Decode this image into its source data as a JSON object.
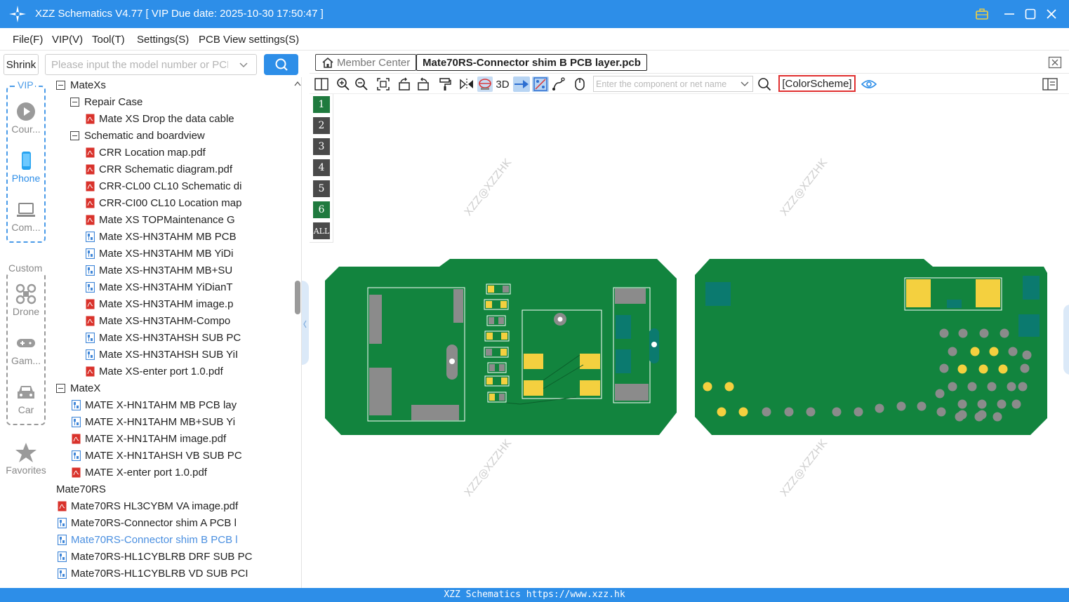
{
  "window": {
    "title": "XZZ Schematics V4.77 [ VIP Due date: 2025-10-30 17:50:47 ]"
  },
  "menu": [
    "File(F)",
    "VIP(V)",
    "Tool(T)",
    "Settings(S)",
    "PCB View settings(S)"
  ],
  "search": {
    "shrink_label": "Shrink",
    "placeholder": "Please input the model number or PCB"
  },
  "rail": {
    "vip_label": "VIP",
    "custom_label": "Custom",
    "items": [
      "Cour...",
      "Phone",
      "Com...",
      "Drone",
      "Gam...",
      "Car",
      "Favorites"
    ]
  },
  "tree": [
    {
      "label": "MateXs",
      "kind": "folder"
    },
    {
      "label": "Repair Case",
      "kind": "folder"
    },
    {
      "label": "Mate XS Drop the data cable",
      "kind": "pdf"
    },
    {
      "label": "Schematic and boardview",
      "kind": "folder"
    },
    {
      "label": "CRR Location map.pdf",
      "kind": "pdf"
    },
    {
      "label": "CRR Schematic diagram.pdf",
      "kind": "pdf"
    },
    {
      "label": "CRR-CL00 CL10 Schematic di",
      "kind": "pdf"
    },
    {
      "label": "CRR-CI00 CL10 Location map",
      "kind": "pdf"
    },
    {
      "label": "Mate XS TOPMaintenance G",
      "kind": "pdf"
    },
    {
      "label": "Mate XS-HN3TAHM MB PCB",
      "kind": "pcb"
    },
    {
      "label": "Mate XS-HN3TAHM MB YiDi",
      "kind": "pcb"
    },
    {
      "label": "Mate XS-HN3TAHM MB+SU",
      "kind": "pcb"
    },
    {
      "label": "Mate XS-HN3TAHM YiDianT",
      "kind": "pcb"
    },
    {
      "label": "Mate XS-HN3TAHM image.p",
      "kind": "pdf"
    },
    {
      "label": "Mate XS-HN3TAHM-Compo",
      "kind": "pdf"
    },
    {
      "label": "Mate XS-HN3TAHSH SUB PC",
      "kind": "pcb"
    },
    {
      "label": "Mate XS-HN3TAHSH SUB YiI",
      "kind": "pcb"
    },
    {
      "label": "Mate XS-enter port 1.0.pdf",
      "kind": "pdf"
    },
    {
      "label": "MateX",
      "kind": "folder"
    },
    {
      "label": "MATE X-HN1TAHM MB PCB lay",
      "kind": "pcb"
    },
    {
      "label": "MATE X-HN1TAHM MB+SUB Yi",
      "kind": "pcb"
    },
    {
      "label": "MATE X-HN1TAHM image.pdf",
      "kind": "pdf"
    },
    {
      "label": "MATE X-HN1TAHSH VB SUB PC",
      "kind": "pcb"
    },
    {
      "label": "MATE X-enter port 1.0.pdf",
      "kind": "pdf"
    },
    {
      "label": "Mate70RS",
      "kind": "folder"
    },
    {
      "label": "Mate70RS HL3CYBM VA image.pdf",
      "kind": "pdf"
    },
    {
      "label": "Mate70RS-Connector shim A PCB l",
      "kind": "pcb"
    },
    {
      "label": "Mate70RS-Connector shim B PCB l",
      "kind": "pcb",
      "selected": true
    },
    {
      "label": "Mate70RS-HL1CYBLRB DRF SUB PC",
      "kind": "pcb"
    },
    {
      "label": "Mate70RS-HL1CYBLRB VD SUB PCI",
      "kind": "pcb"
    }
  ],
  "tabs": {
    "member_center": "Member Center",
    "active_file": "Mate70RS-Connector shim B PCB layer.pcb"
  },
  "toolbar": {
    "three_d": "3D",
    "component_placeholder": "Enter the component or net name",
    "color_scheme": "[ColorScheme]"
  },
  "layers": [
    "1",
    "2",
    "3",
    "4",
    "5",
    "6",
    "ALL"
  ],
  "watermark": "XZZ@XZZHK",
  "status": "XZZ Schematics https://www.xzz.hk",
  "colors": {
    "accent": "#2d8ee8",
    "board": "#12843e",
    "pad": "#f4d03f",
    "layer_active": "#1f7a3e",
    "layer_inactive": "#4a4a4a"
  }
}
